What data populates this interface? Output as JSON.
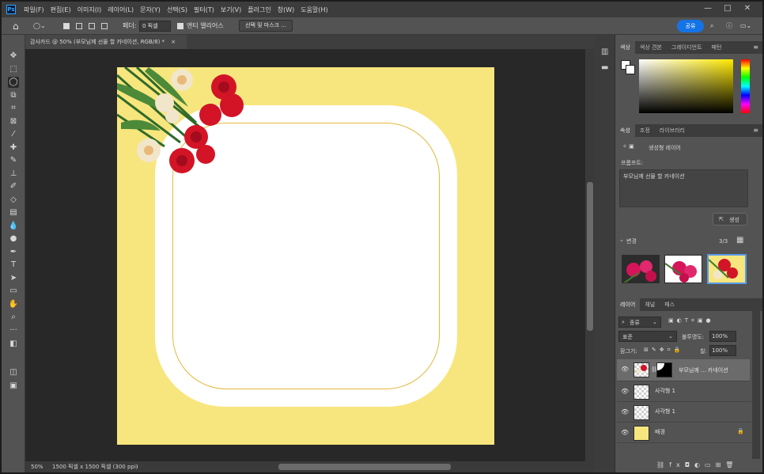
{
  "app": {
    "logo": "Ps"
  },
  "menu": [
    "파일(F)",
    "편집(E)",
    "이미지(I)",
    "레이어(L)",
    "문자(Y)",
    "선택(S)",
    "필터(T)",
    "보기(V)",
    "플러그인",
    "창(W)",
    "도움말(H)"
  ],
  "window_controls": {
    "minimize": "—",
    "maximize": "□",
    "close": "✕"
  },
  "options_bar": {
    "feather_label": "페더:",
    "feather_value": "0 픽셀",
    "antialias_label": "앤티 앨리어스",
    "select_mask_label": "선택 및 마스크 ...",
    "share_label": "공유"
  },
  "document": {
    "tab_title": "감사카드 @ 50% (부모님께 선물 할 카네이션, RGB/8) *",
    "zoom": "50%",
    "info": "1500 픽셀 x 1500 픽셀 (300 ppi)"
  },
  "color_panel": {
    "tabs": [
      "색상",
      "색상 견본",
      "그레이디언트",
      "패턴"
    ],
    "hue_gradient": [
      "#ff0000",
      "#ffff00",
      "#00ff00",
      "#00ffff",
      "#0000ff",
      "#ff00ff",
      "#ff0000"
    ],
    "field_hue": "#ffea00"
  },
  "properties_panel": {
    "tabs": [
      "속성",
      "조정",
      "라이브러리"
    ],
    "layer_type": "생성형 레이어",
    "prompt_label": "프롬프트:",
    "prompt_text": "부모님께 선물 할 카네이션",
    "generate_button": "생성",
    "variations_label": "변경",
    "variations_count": "3/3"
  },
  "layers_panel": {
    "tabs": [
      "레이어",
      "채널",
      "패스"
    ],
    "filter_kind": "종류",
    "blend_mode": "표준",
    "opacity_label": "불투명도:",
    "opacity_value": "100%",
    "lock_label": "잠그기:",
    "fill_label": "칠:",
    "fill_value": "100%",
    "layers": [
      {
        "name": "부모님께 ... 카네이션",
        "selected": true
      },
      {
        "name": "사각형 1",
        "selected": false
      },
      {
        "name": "사각형 1",
        "selected": false
      },
      {
        "name": "배경",
        "selected": false,
        "locked": true
      }
    ]
  },
  "colors": {
    "canvas_background": "#f7e67d",
    "frame_white": "#ffffff",
    "frame_line": "#e2b93b",
    "accent": "#1473e6"
  }
}
